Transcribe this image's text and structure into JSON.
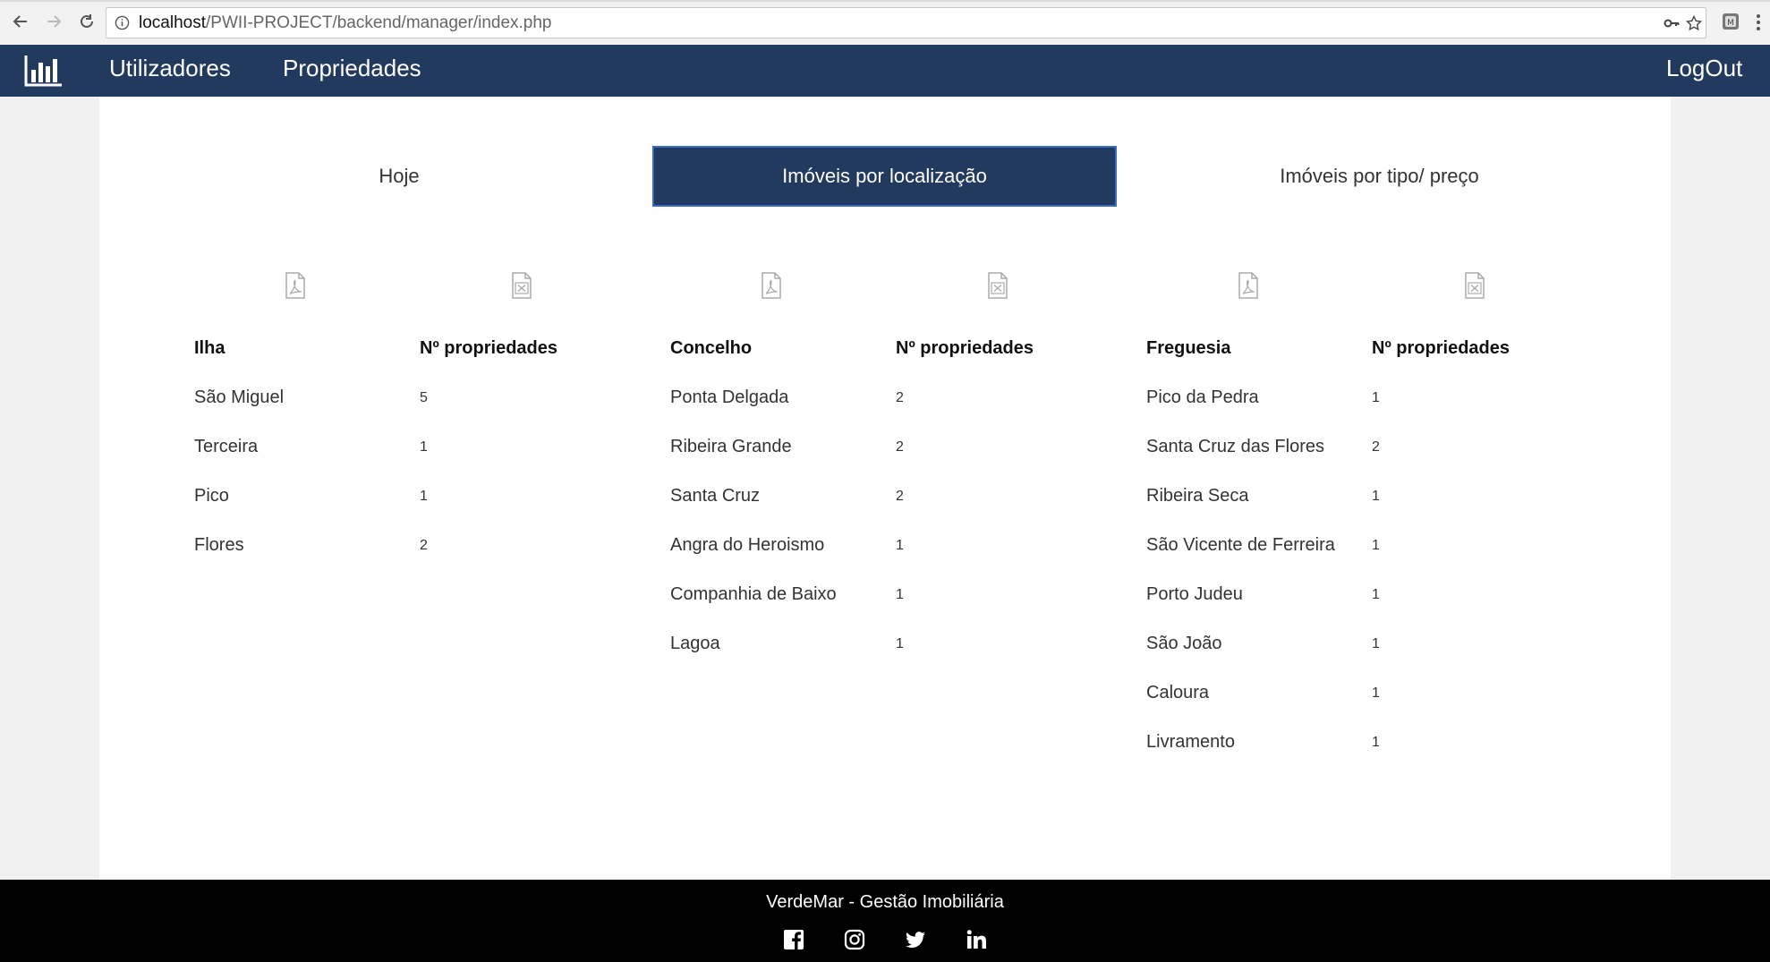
{
  "browser": {
    "url_host": "localhost",
    "url_path": "/PWII-PROJECT/backend/manager/index.php",
    "icons": [
      "back-arrow-icon",
      "forward-arrow-icon",
      "reload-icon",
      "info-icon",
      "key-icon",
      "star-icon",
      "extension-icon",
      "menu-icon"
    ]
  },
  "navbar": {
    "brand_icon": "bar-chart-icon",
    "links": [
      "Utilizadores",
      "Propriedades"
    ],
    "logout": "LogOut",
    "color": "#223a5e"
  },
  "tabs": [
    {
      "label": "Hoje",
      "active": false
    },
    {
      "label": "Imóveis por localização",
      "active": true
    },
    {
      "label": "Imóveis por tipo/ preço",
      "active": false
    }
  ],
  "export_icons": [
    "pdf-icon",
    "excel-icon"
  ],
  "tables": [
    {
      "header": [
        "Ilha",
        "Nº propriedades"
      ],
      "rows": [
        [
          "São Miguel",
          "5"
        ],
        [
          "Terceira",
          "1"
        ],
        [
          "Pico",
          "1"
        ],
        [
          "Flores",
          "2"
        ]
      ]
    },
    {
      "header": [
        "Concelho",
        "Nº propriedades"
      ],
      "rows": [
        [
          "Ponta Delgada",
          "2"
        ],
        [
          "Ribeira Grande",
          "2"
        ],
        [
          "Santa Cruz",
          "2"
        ],
        [
          "Angra do Heroismo",
          "1"
        ],
        [
          "Companhia de Baixo",
          "1"
        ],
        [
          "Lagoa",
          "1"
        ]
      ]
    },
    {
      "header": [
        "Freguesia",
        "Nº propriedades"
      ],
      "rows": [
        [
          "Pico da Pedra",
          "1"
        ],
        [
          "Santa Cruz das Flores",
          "2"
        ],
        [
          "Ribeira Seca",
          "1"
        ],
        [
          "São Vicente de Ferreira",
          "1"
        ],
        [
          "Porto Judeu",
          "1"
        ],
        [
          "São João",
          "1"
        ],
        [
          "Caloura",
          "1"
        ],
        [
          "Livramento",
          "1"
        ]
      ]
    }
  ],
  "footer": {
    "title": "VerdeMar - Gestão Imobiliária",
    "social": [
      "facebook-icon",
      "instagram-icon",
      "twitter-icon",
      "linkedin-icon"
    ]
  }
}
